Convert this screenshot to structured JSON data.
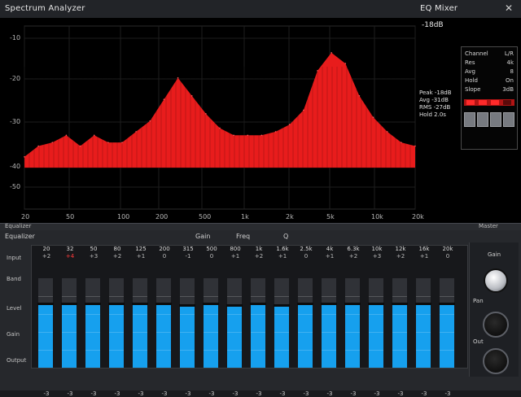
{
  "window": {
    "title": "Spectrum Analyzer",
    "right_title": "EQ Mixer",
    "close": "✕"
  },
  "analyzer": {
    "peak_readout": "-18dB",
    "y_ticks": [
      "-10",
      "-20",
      "-30",
      "-40",
      "-50"
    ],
    "x_ticks": [
      "20",
      "50",
      "100",
      "200",
      "500",
      "1k",
      "2k",
      "5k",
      "10k",
      "20k"
    ],
    "curve_color": "#e81c1c",
    "levels_db": [
      -37,
      -34,
      -33,
      -31,
      -34,
      -31,
      -33,
      -33,
      -30,
      -27,
      -21,
      -15,
      -20,
      -25,
      -29,
      -31,
      -31,
      -31,
      -30,
      -28,
      -24,
      -13,
      -8,
      -11,
      -20,
      -26,
      -30,
      -33,
      -34
    ],
    "marker_text": [
      "Peak -18dB",
      "Avg -31dB",
      "RMS -27dB",
      "Hold 2.0s"
    ],
    "side_panel": {
      "rows": [
        {
          "label": "Channel",
          "value": "L/R"
        },
        {
          "label": "Res",
          "value": "4k"
        },
        {
          "label": "Avg",
          "value": "8"
        },
        {
          "label": "Hold",
          "value": "On"
        },
        {
          "label": "Slope",
          "value": "3dB"
        }
      ],
      "led_levels": [
        1,
        1,
        1,
        0
      ]
    }
  },
  "mixer": {
    "section_title": "Equalizer",
    "right_label": "Master",
    "header_labels": [
      "Gain",
      "Freq",
      "Q"
    ],
    "left_labels": [
      "Input",
      "Band",
      "Level",
      "Gain",
      "Output"
    ],
    "accent": "#16a0ee",
    "channels": [
      {
        "name": "20",
        "sub": "+2",
        "level": 0.71,
        "bottom": "-3"
      },
      {
        "name": "32",
        "sub": "+4",
        "level": 0.71,
        "bottom": "-3"
      },
      {
        "name": "50",
        "sub": "+3",
        "level": 0.71,
        "bottom": "-3"
      },
      {
        "name": "80",
        "sub": "+2",
        "level": 0.71,
        "bottom": "-3"
      },
      {
        "name": "125",
        "sub": "+1",
        "level": 0.71,
        "bottom": "-3"
      },
      {
        "name": "200",
        "sub": "0",
        "level": 0.71,
        "bottom": "-3"
      },
      {
        "name": "315",
        "sub": "-1",
        "level": 0.69,
        "bottom": "-3"
      },
      {
        "name": "500",
        "sub": "0",
        "level": 0.71,
        "bottom": "-3"
      },
      {
        "name": "800",
        "sub": "+1",
        "level": 0.69,
        "bottom": "-3"
      },
      {
        "name": "1k",
        "sub": "+2",
        "level": 0.71,
        "bottom": "-3"
      },
      {
        "name": "1.6k",
        "sub": "+1",
        "level": 0.69,
        "bottom": "-3"
      },
      {
        "name": "2.5k",
        "sub": "0",
        "level": 0.71,
        "bottom": "-3"
      },
      {
        "name": "4k",
        "sub": "+1",
        "level": 0.71,
        "bottom": "-3"
      },
      {
        "name": "6.3k",
        "sub": "+2",
        "level": 0.71,
        "bottom": "-3"
      },
      {
        "name": "10k",
        "sub": "+3",
        "level": 0.71,
        "bottom": "-3"
      },
      {
        "name": "12k",
        "sub": "+2",
        "level": 0.71,
        "bottom": "-3"
      },
      {
        "name": "16k",
        "sub": "+1",
        "level": 0.71,
        "bottom": "-3"
      },
      {
        "name": "20k",
        "sub": "0",
        "level": 0.71,
        "bottom": "-3"
      }
    ],
    "knobs": [
      {
        "label": "Gain"
      },
      {
        "label": "Pan"
      },
      {
        "label": "Out"
      }
    ]
  }
}
